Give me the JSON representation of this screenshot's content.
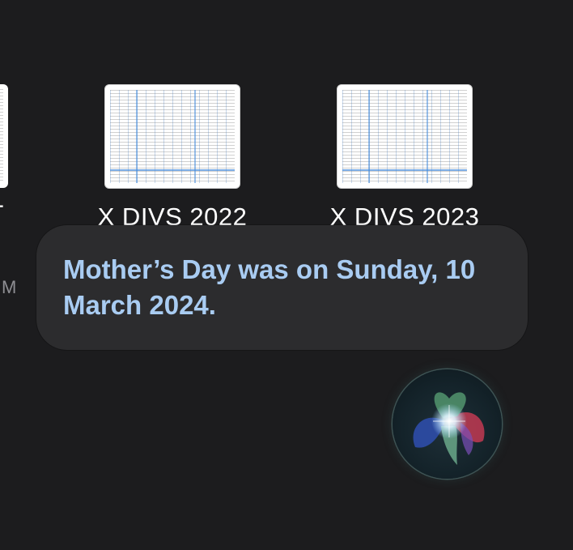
{
  "partial_file": {
    "label": "T",
    "sub": "M"
  },
  "files": [
    {
      "name": "X DIVS 2022",
      "icon": "spreadsheet-thumbnail"
    },
    {
      "name": "X DIVS 2023",
      "icon": "spreadsheet-thumbnail"
    }
  ],
  "siri": {
    "response": "Mother’s Day was on Sunday, 10 March 2024.",
    "orb_icon": "siri-orb-icon"
  },
  "colors": {
    "background": "#1c1c1e",
    "bubble": "#2c2c2e",
    "siri_text": "#a9ccf2"
  }
}
